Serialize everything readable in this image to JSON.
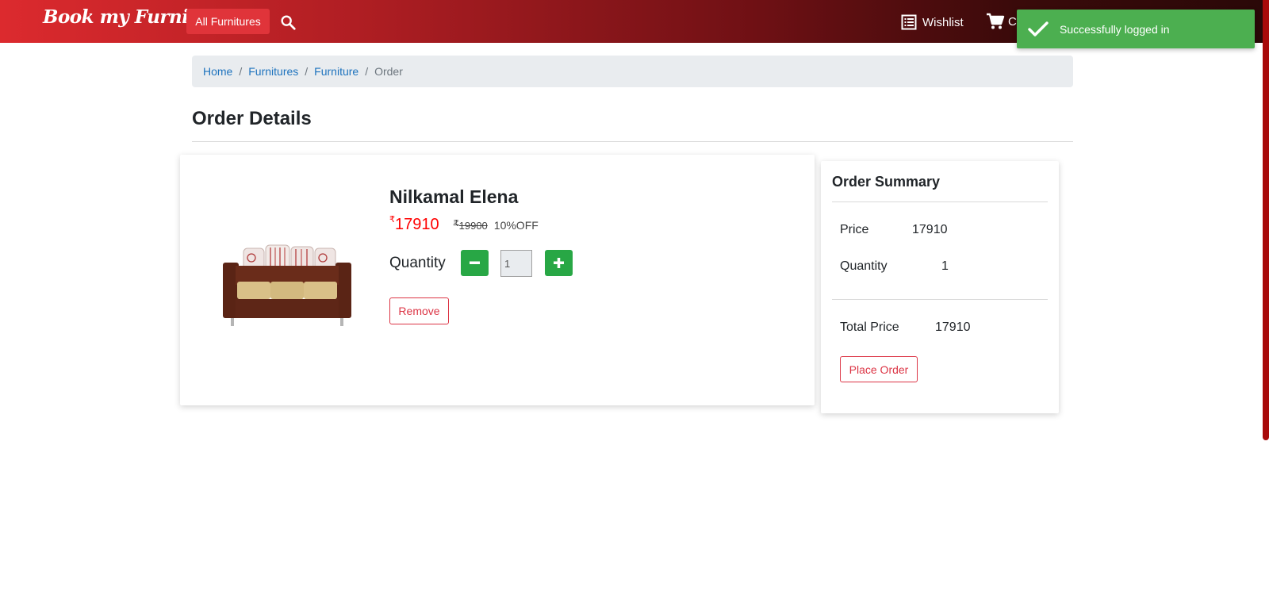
{
  "header": {
    "brand": "Book my Furniture",
    "all_label": "All Furnitures",
    "wishlist_label": "Wishlist",
    "cart_label": "C"
  },
  "toast": {
    "message": "Successfully logged in"
  },
  "breadcrumb": {
    "items": [
      "Home",
      "Furnitures",
      "Furniture"
    ],
    "current": "Order",
    "separator": "/"
  },
  "page": {
    "title": "Order Details"
  },
  "product": {
    "name": "Nilkamal Elena",
    "currency": "₹",
    "price": "17910",
    "mrp": "19900",
    "discount": "10%OFF",
    "quantity_label": "Quantity",
    "quantity": "1",
    "remove_label": "Remove"
  },
  "summary": {
    "title": "Order Summary",
    "price_label": "Price",
    "price_value": "17910",
    "quantity_label": "Quantity",
    "quantity_value": "1",
    "total_label": "Total Price",
    "total_value": "17910",
    "place_order_label": "Place Order"
  },
  "colors": {
    "nav_gradient_start": "#dc2a2e",
    "nav_gradient_end": "#2a0808",
    "toast_bg": "#4caf50",
    "price_red": "#ff0000",
    "qty_button_green": "#28a745",
    "outline_red": "#dc3545",
    "link_blue": "#1e73be"
  }
}
